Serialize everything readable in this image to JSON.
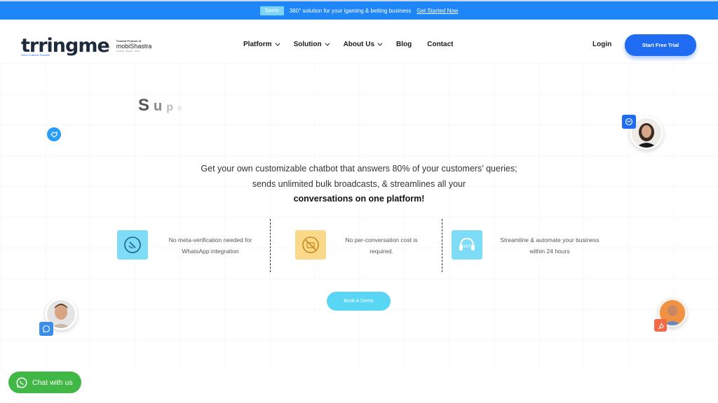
{
  "announcement": {
    "badge": "Sports",
    "text": "360° solution for your igaming & betting business",
    "link": "Get Started Now"
  },
  "brand": {
    "name": "trringme",
    "tagline": "Omni Channel Solution",
    "partner_label": "Trusted Product of",
    "partner_name": "mobiShastra",
    "partner_sub": "Connect · Secure · Grow"
  },
  "nav": {
    "items": [
      {
        "label": "Platform",
        "dropdown": true
      },
      {
        "label": "Solution",
        "dropdown": true
      },
      {
        "label": "About Us",
        "dropdown": true
      },
      {
        "label": "Blog",
        "dropdown": false
      },
      {
        "label": "Contact",
        "dropdown": false
      }
    ],
    "login": "Login",
    "cta": "Start Free Trial"
  },
  "hero": {
    "typing_text": [
      "S",
      "u",
      "p",
      "e"
    ],
    "line1": "Get your own customizable chatbot that answers 80% of your customers’ queries;",
    "line2": "sends unlimited bulk broadcasts, & streamlines all your",
    "line3": "conversations on one platform!"
  },
  "features": [
    {
      "line1": "No meta-verification needed for",
      "line2": "WhatsApp integration",
      "icon": "no-verification-icon",
      "color": "#7fdcf7"
    },
    {
      "line1": "No per-conversation cost is",
      "line2": "required.",
      "icon": "no-cost-icon",
      "color": "#fbd98a"
    },
    {
      "line1": "Streamline & automate your business",
      "line2": "within 24 hours",
      "icon": "support-24-7-icon",
      "color": "#7fdcf7"
    }
  ],
  "demo_button": "Book A Demo",
  "chat_widget": {
    "label": "Chat with us",
    "icon": "whatsapp-icon"
  },
  "colors": {
    "primary": "#1f6cf2",
    "topbar": "#1f86f7",
    "cyan": "#5ad6f5",
    "whatsapp": "#41b846"
  }
}
